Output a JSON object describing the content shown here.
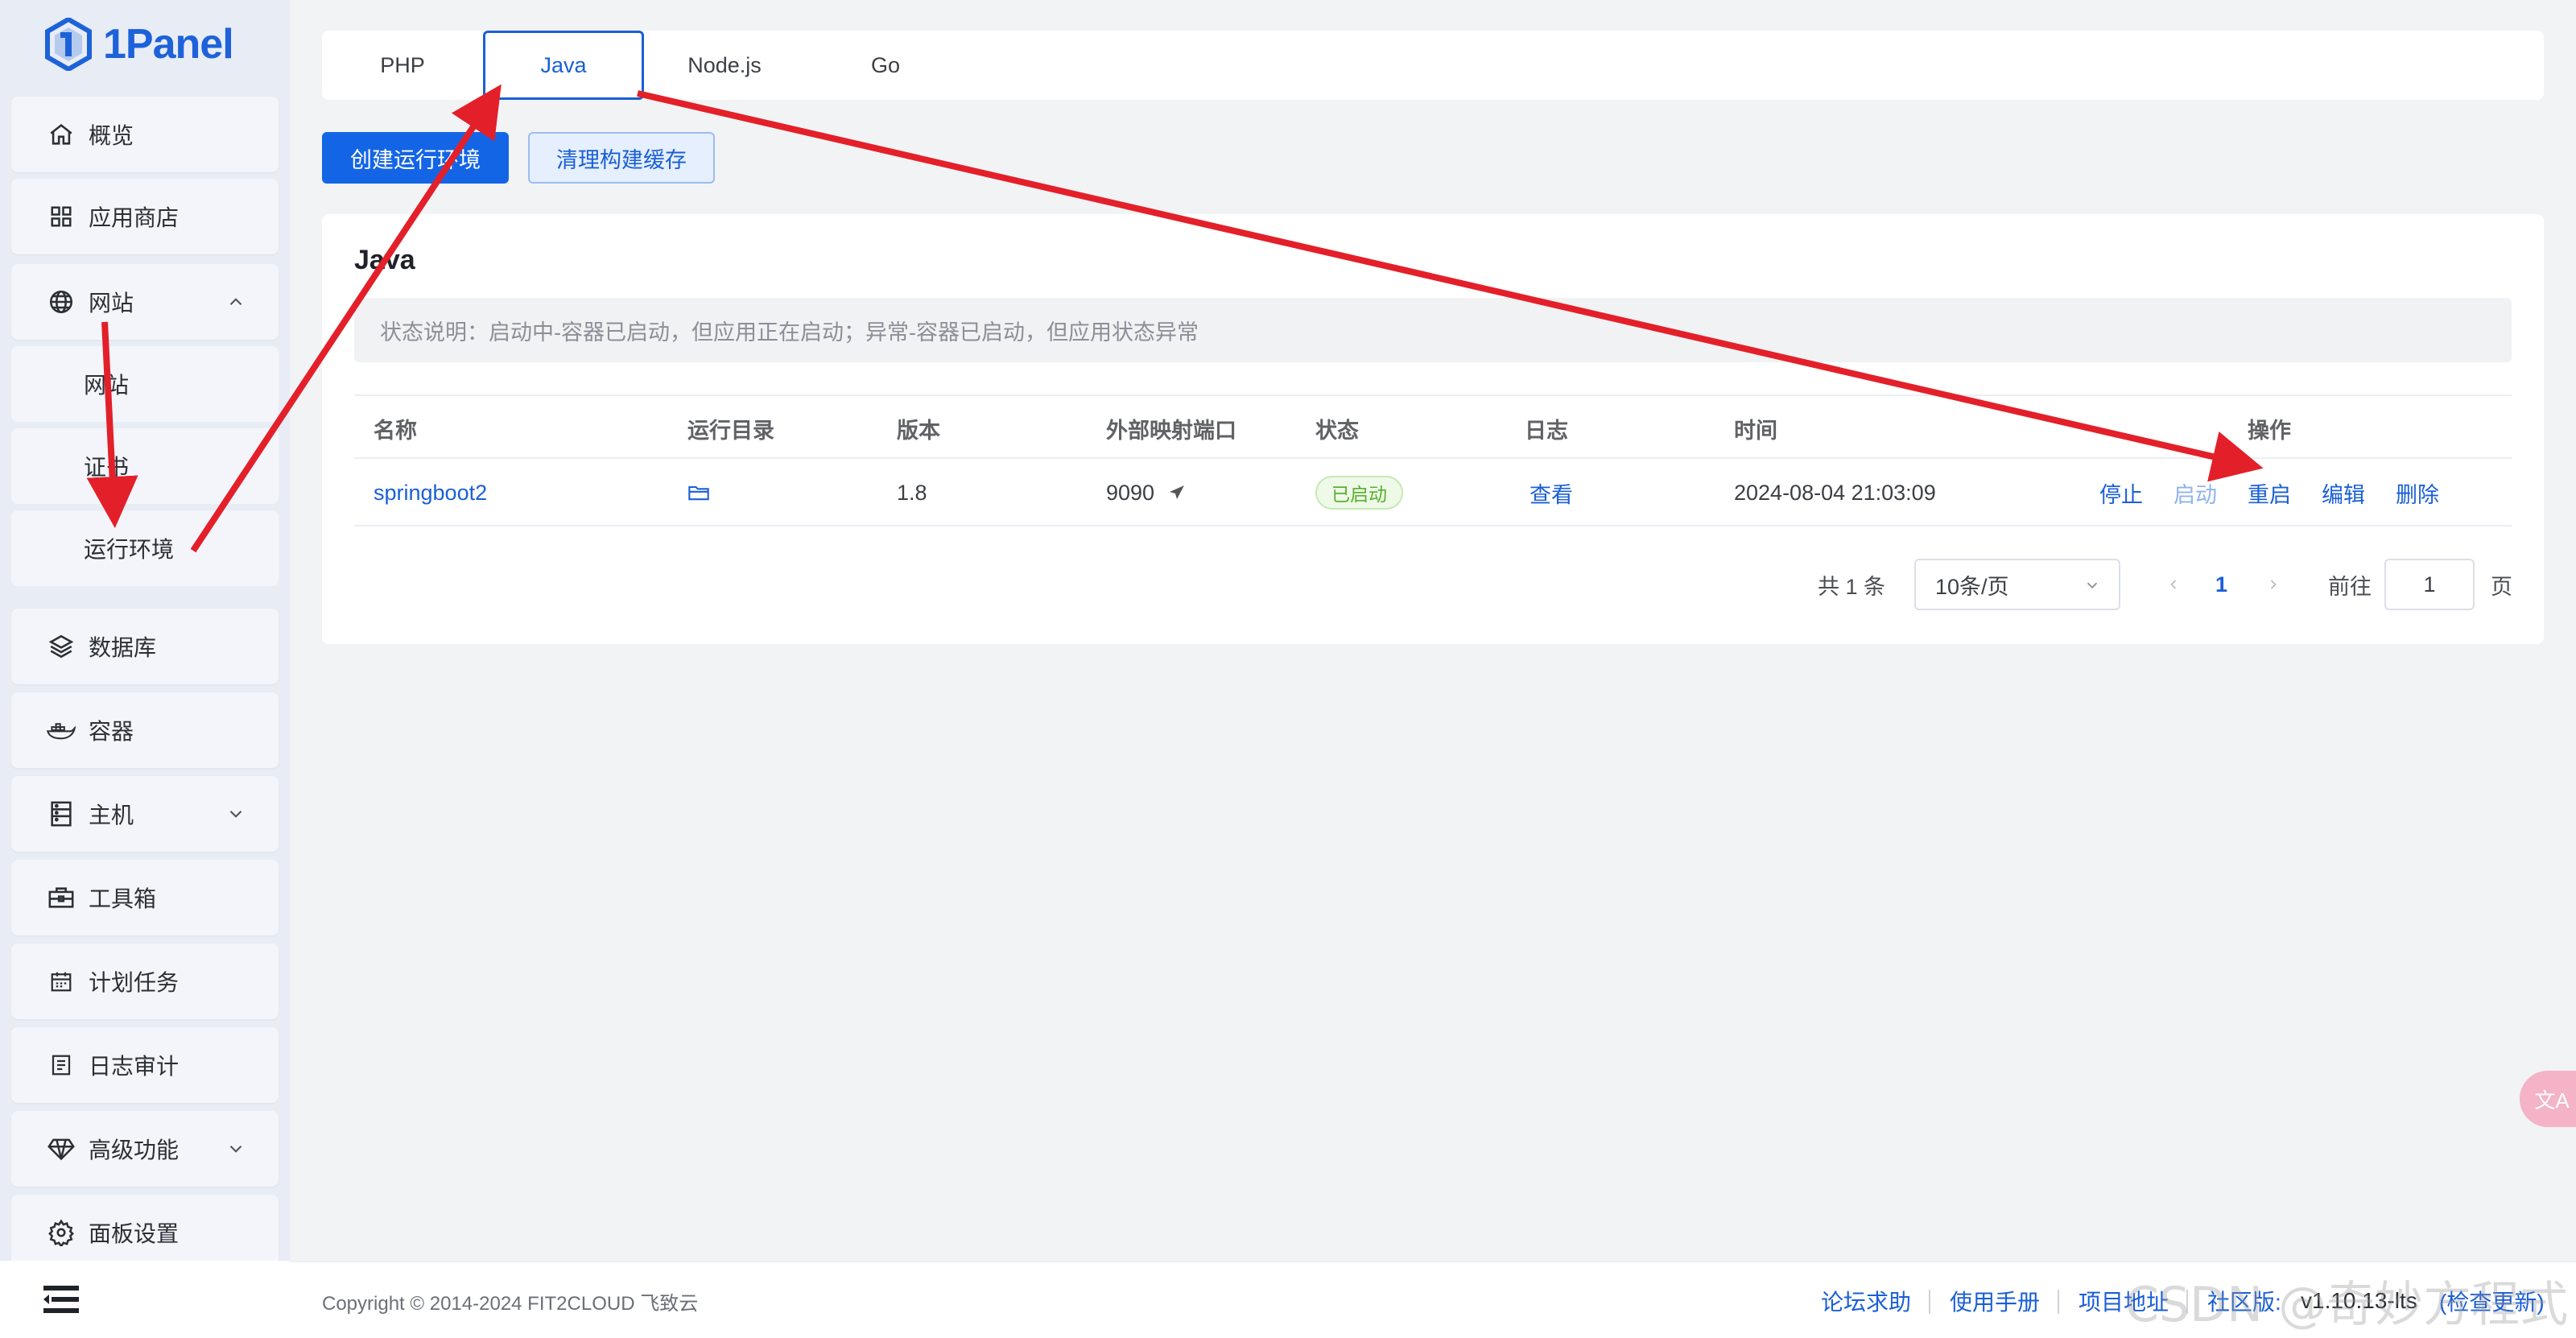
{
  "app": {
    "brand": "1Panel",
    "accent": "#1465e6"
  },
  "sidebar": {
    "items": [
      {
        "label": "概览",
        "icon": "home-icon"
      },
      {
        "label": "应用商店",
        "icon": "grid-icon"
      },
      {
        "label": "网站",
        "icon": "globe-icon",
        "expanded": true
      },
      {
        "label": "数据库",
        "icon": "layers-icon"
      },
      {
        "label": "容器",
        "icon": "docker-icon"
      },
      {
        "label": "主机",
        "icon": "server-icon"
      },
      {
        "label": "工具箱",
        "icon": "toolbox-icon"
      },
      {
        "label": "计划任务",
        "icon": "calendar-icon"
      },
      {
        "label": "日志审计",
        "icon": "log-icon"
      },
      {
        "label": "高级功能",
        "icon": "diamond-icon"
      },
      {
        "label": "面板设置",
        "icon": "gear-icon"
      }
    ],
    "subitems": [
      {
        "label": "网站"
      },
      {
        "label": "证书"
      },
      {
        "label": "运行环境"
      }
    ]
  },
  "tabs": [
    {
      "label": "PHP"
    },
    {
      "label": "Java",
      "active": true
    },
    {
      "label": "Node.js"
    },
    {
      "label": "Go"
    }
  ],
  "toolbar": {
    "create_label": "创建运行环境",
    "clear_cache_label": "清理构建缓存"
  },
  "card": {
    "title": "Java",
    "notice": "状态说明：启动中-容器已启动，但应用正在启动；异常-容器已启动，但应用状态异常"
  },
  "table": {
    "columns": [
      "名称",
      "运行目录",
      "版本",
      "外部映射端口",
      "状态",
      "日志",
      "时间",
      "操作"
    ],
    "rows": [
      {
        "name": "springboot2",
        "version": "1.8",
        "port": "9090",
        "status": "已启动",
        "log": "查看",
        "time": "2024-08-04 21:03:09",
        "actions": [
          "停止",
          "启动",
          "重启",
          "编辑",
          "删除"
        ]
      }
    ]
  },
  "pagination": {
    "total": "共 1 条",
    "page_size": "10条/页",
    "current": "1",
    "goto_label": "前往",
    "goto_value": "1",
    "page_suffix": "页"
  },
  "footer": {
    "copyright": "Copyright © 2014-2024 FIT2CLOUD 飞致云",
    "links": [
      "论坛求助",
      "使用手册",
      "项目地址",
      "社区版:"
    ],
    "version": "v1.10.13-lts",
    "check_update": "(检查更新)"
  },
  "watermark": "CSDN @奇妙方程式",
  "translate_label": "文A"
}
